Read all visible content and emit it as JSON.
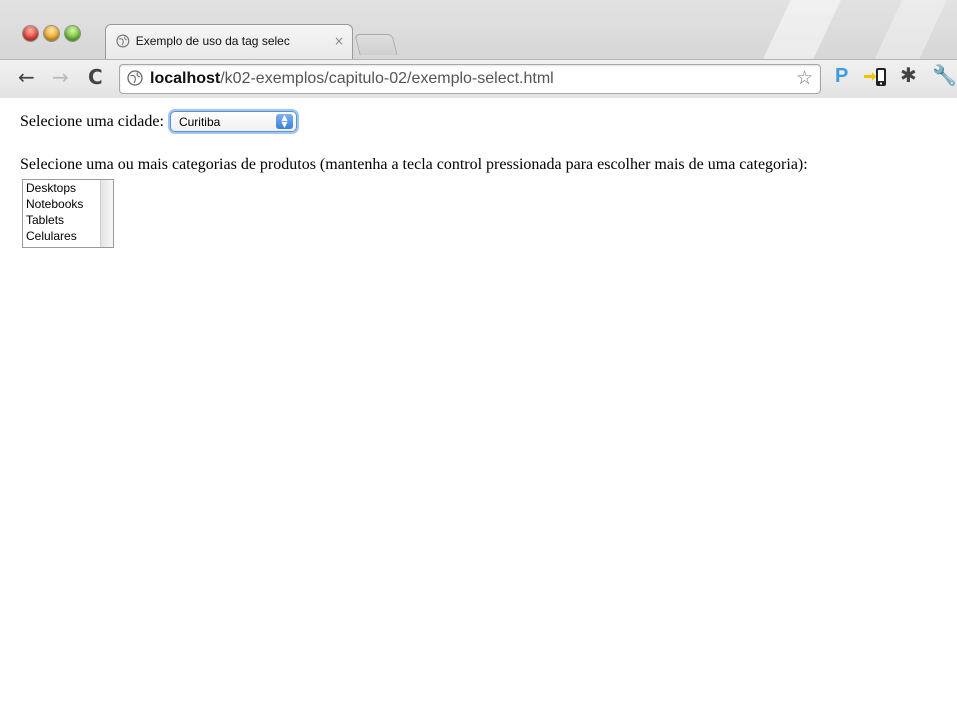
{
  "tab": {
    "title": "Exemplo de uso da tag selec",
    "close": "×"
  },
  "nav": {
    "back": "←",
    "forward": "→",
    "reload": "C"
  },
  "omnibox": {
    "host": "localhost",
    "path": "/k02-exemplos/capitulo-02/exemplo-select.html",
    "star": "☆"
  },
  "extensions": {
    "p_label": "P",
    "gear": "✱",
    "wrench": "🔧"
  },
  "page": {
    "city_label": "Selecione uma cidade:",
    "city_selected": "Curitiba",
    "categories_label": "Selecione uma ou mais categorias de produtos (mantenha a tecla control pressionada para escolher mais de uma categoria):",
    "categories": [
      "Desktops",
      "Notebooks",
      "Tablets",
      "Celulares"
    ]
  },
  "colors": {
    "focus_ring": "#5b8fd6",
    "select_arrows": "#3a82dc",
    "ext_p": "#3c9ee0"
  }
}
